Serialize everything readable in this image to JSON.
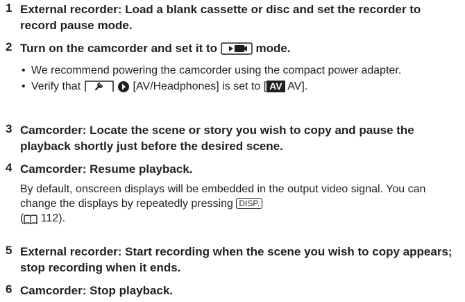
{
  "steps": [
    {
      "number": "1",
      "heading": "External recorder: Load a blank cassette or disc and set the recorder to record pause mode."
    },
    {
      "number": "2",
      "heading_before": "Turn on the camcorder and set it to",
      "heading_after": "mode.",
      "mode_icon": "playback-mode-icon",
      "bullets": [
        {
          "text": "We recommend powering the camcorder using the compact power adapter."
        },
        {
          "before": "Verify that",
          "menu_icon": "wrench-setup-icon",
          "arrow_icon": "right-arrow-icon",
          "menu_item": "[AV/Headphones] is set to [",
          "badge": "AV",
          "after": " AV]."
        }
      ]
    },
    {
      "number": "3",
      "heading": "Camcorder: Locate the scene or story you wish to copy and pause the playback shortly just before the desired scene."
    },
    {
      "number": "4",
      "heading": "Camcorder: Resume playback.",
      "para_before": "By default, onscreen displays will be embedded in the output video signal. You can change the displays by repeatedly pressing",
      "button_label": "DISP.",
      "ref_open": "(",
      "book_icon": "book-reference-icon",
      "ref_page": " 112).",
      "ref_tail": ""
    },
    {
      "number": "5",
      "heading": "External recorder: Start recording when the scene you wish to copy appears; stop recording when it ends."
    },
    {
      "number": "6",
      "heading": "Camcorder: Stop playback."
    }
  ]
}
